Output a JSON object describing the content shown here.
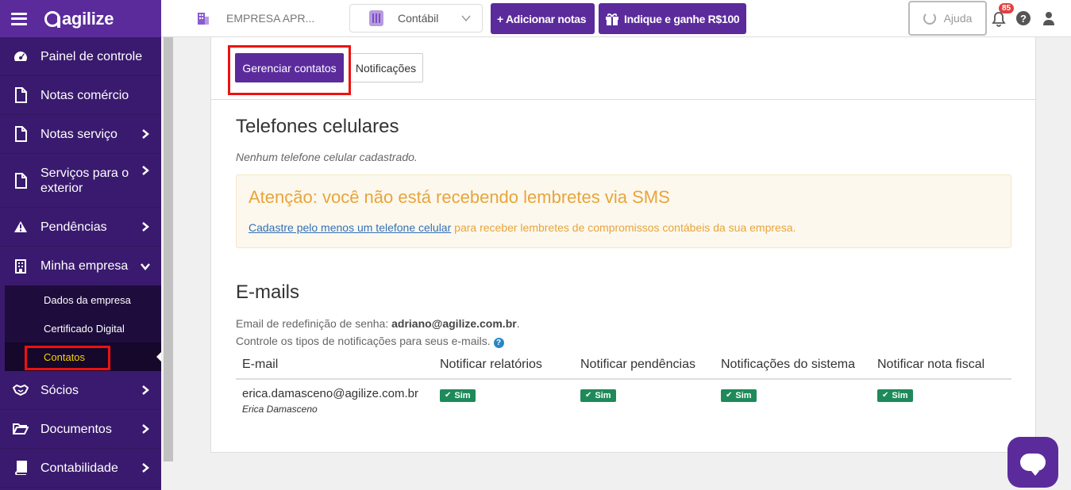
{
  "app": {
    "logo_text": "agilize"
  },
  "topbar": {
    "company_name": "EMPRESA APR...",
    "selector_value": "Contábil",
    "add_notes_label": "+ Adicionar notas",
    "referral_label": "Indique e ganhe R$100",
    "help_label": "Ajuda",
    "notification_count": "85",
    "qmark_glyph": "?"
  },
  "sidebar": {
    "items": [
      {
        "label": "Painel de controle",
        "icon": "dashboard-icon"
      },
      {
        "label": "Notas comércio",
        "icon": "document-icon"
      },
      {
        "label": "Notas serviço",
        "icon": "document-icon"
      },
      {
        "label": "Serviços para o exterior",
        "icon": "document-icon"
      },
      {
        "label": "Pendências",
        "icon": "warning-icon"
      },
      {
        "label": "Minha empresa",
        "icon": "building-icon"
      },
      {
        "label": "Sócios",
        "icon": "handshake-icon"
      },
      {
        "label": "Documentos",
        "icon": "folder-icon"
      },
      {
        "label": "Contabilidade",
        "icon": "book-icon"
      }
    ],
    "submenu": [
      {
        "label": "Dados da empresa"
      },
      {
        "label": "Certificado Digital"
      },
      {
        "label": "Contatos"
      }
    ]
  },
  "tabs": {
    "manage_contacts": "Gerenciar contatos",
    "notifications": "Notificações"
  },
  "phones": {
    "title": "Telefones celulares",
    "empty_note": "Nenhum telefone celular cadastrado.",
    "alert_title": "Atenção: você não está recebendo lembretes via SMS",
    "alert_link": "Cadastre pelo menos um telefone celular",
    "alert_text": " para receber lembretes de compromissos contábeis da sua empresa."
  },
  "emails": {
    "title": "E-mails",
    "reset_prefix": "Email de redefinição de senha: ",
    "reset_email": "adriano@agilize.com.br",
    "reset_suffix": ".",
    "control_note": "Controle os tipos de notificações para seus e-mails.",
    "info_glyph": "?",
    "columns": [
      "E-mail",
      "Notificar relatórios",
      "Notificar pendências",
      "Notificações do sistema",
      "Notificar nota fiscal"
    ],
    "rows": [
      {
        "email": "erica.damasceno@agilize.com.br",
        "name": "Erica Damasceno",
        "reports": "Sim",
        "pending": "Sim",
        "system": "Sim",
        "invoice": "Sim"
      }
    ]
  },
  "colors": {
    "brand": "#5b2b9c",
    "sidebar": "#3a1a6e",
    "success": "#1e8a5a",
    "warning": "#e8a53a",
    "highlight_box": "#ee1111"
  }
}
